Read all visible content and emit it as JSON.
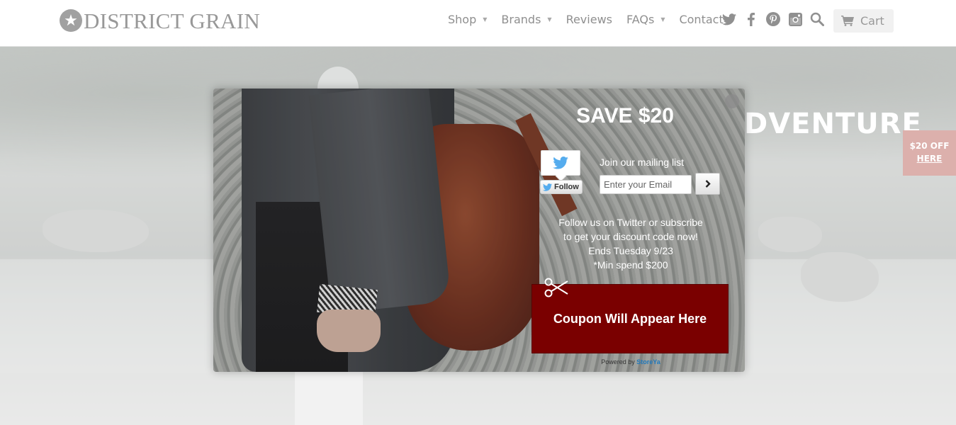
{
  "header": {
    "logo_text": "DISTRICT GRAIN",
    "nav": [
      {
        "label": "Shop",
        "has_dropdown": true
      },
      {
        "label": "Brands",
        "has_dropdown": true
      },
      {
        "label": "Reviews",
        "has_dropdown": false
      },
      {
        "label": "FAQs",
        "has_dropdown": true
      },
      {
        "label": "Contact",
        "has_dropdown": false
      }
    ],
    "social_icons": [
      "twitter-icon",
      "facebook-icon",
      "pinterest-icon",
      "instagram-icon",
      "search-icon"
    ],
    "cart_label": "Cart"
  },
  "hero": {
    "heading_partial": "DVENTURE",
    "side_tab_line1": "$20 OFF",
    "side_tab_line2": "HERE"
  },
  "popup": {
    "title": "SAVE $20",
    "twitter_follow_label": "Follow",
    "mailing_label": "Join our mailing list",
    "email_placeholder": "Enter your Email",
    "promo_lines": [
      "Follow us on Twitter or subscribe",
      "to get your discount code now!",
      "Ends Tuesday 9/23",
      "*Min spend $200"
    ],
    "coupon_text": "Coupon Will Appear Here",
    "powered_prefix": "Powered by",
    "powered_brand": "StoreYa"
  },
  "colors": {
    "coupon_bg": "#7a0000",
    "twitter_blue": "#55acee",
    "side_tab_bg": "#dcb0ac",
    "nav_text": "#8f8f8f"
  }
}
